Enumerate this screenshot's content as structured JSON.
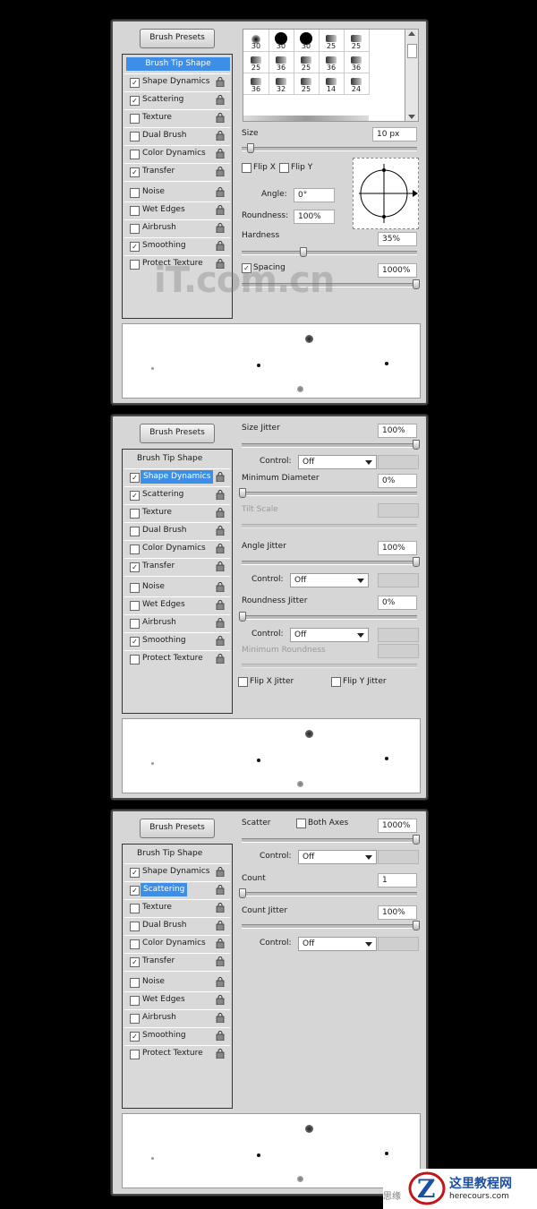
{
  "colors": {
    "selection": "#3d8ee6",
    "panel": "#d6d6d6",
    "background": "#000000"
  },
  "brush_presets_label": "Brush Presets",
  "list_items": [
    "Brush Tip Shape",
    "Shape Dynamics",
    "Scattering",
    "Texture",
    "Dual Brush",
    "Color Dynamics",
    "Transfer",
    "Noise",
    "Wet Edges",
    "Airbrush",
    "Smoothing",
    "Protect Texture"
  ],
  "panel1": {
    "checked": [
      false,
      true,
      true,
      false,
      false,
      false,
      true,
      false,
      false,
      false,
      true,
      false
    ],
    "selected": "Brush Tip Shape",
    "tip_sizes": [
      "30",
      "30",
      "30",
      "25",
      "25",
      "25",
      "36",
      "25",
      "36",
      "36",
      "36",
      "32",
      "25",
      "14",
      "24"
    ],
    "size_label": "Size",
    "size_value": "10 px",
    "flip_x": "Flip X",
    "flip_y": "Flip Y",
    "angle_label": "Angle:",
    "angle_value": "0°",
    "roundness_label": "Roundness:",
    "roundness_value": "100%",
    "hardness_label": "Hardness",
    "hardness_value": "35%",
    "spacing_label": "Spacing",
    "spacing_value": "1000%",
    "watermark": "iT.com.cn"
  },
  "panel2": {
    "checked": [
      false,
      true,
      true,
      false,
      false,
      false,
      true,
      false,
      false,
      false,
      true,
      false
    ],
    "selected": "Shape Dynamics",
    "size_jitter": "Size Jitter",
    "size_jitter_value": "100%",
    "control": "Control:",
    "control_value": "Off",
    "min_diameter": "Minimum Diameter",
    "min_diameter_value": "0%",
    "tilt_scale": "Tilt Scale",
    "angle_jitter": "Angle Jitter",
    "angle_jitter_value": "100%",
    "roundness_jitter": "Roundness Jitter",
    "roundness_jitter_value": "0%",
    "min_roundness": "Minimum Roundness",
    "flip_x_jitter": "Flip X Jitter",
    "flip_y_jitter": "Flip Y Jitter"
  },
  "panel3": {
    "checked": [
      false,
      true,
      true,
      false,
      false,
      false,
      true,
      false,
      false,
      false,
      true,
      false
    ],
    "selected": "Scattering",
    "scatter": "Scatter",
    "both_axes": "Both Axes",
    "scatter_value": "1000%",
    "control": "Control:",
    "control_value": "Off",
    "count": "Count",
    "count_value": "1",
    "count_jitter": "Count Jitter",
    "count_jitter_value": "100%"
  },
  "footer": {
    "logo_text": "这里教程网",
    "logo_url": "herecours.com",
    "small": "思缘"
  }
}
